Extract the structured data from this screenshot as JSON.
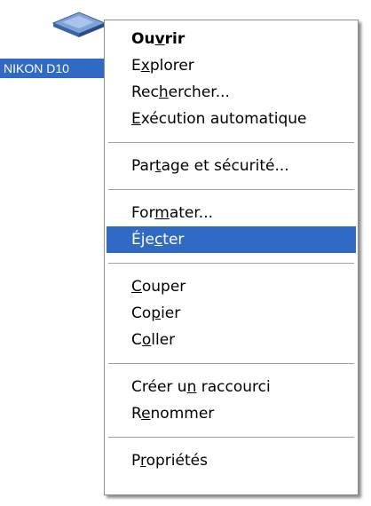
{
  "drive": {
    "label": "NIKON D10",
    "icon": "removable-drive-icon"
  },
  "menu": {
    "open": {
      "pre": "Ou",
      "mn": "v",
      "post": "rir"
    },
    "explore": {
      "pre": "E",
      "mn": "x",
      "post": "plorer"
    },
    "search": {
      "pre": "Rec",
      "mn": "h",
      "post": "ercher..."
    },
    "autoplay": {
      "pre": "",
      "mn": "E",
      "post": "xécution automatique",
      "full": "Exécution automatique"
    },
    "sharing": {
      "pre": "Par",
      "mn": "t",
      "post": "age et sécurité..."
    },
    "format": {
      "pre": "For",
      "mn": "m",
      "post": "ater..."
    },
    "eject": {
      "pre": "Éje",
      "mn": "c",
      "post": "ter"
    },
    "cut": {
      "pre": "",
      "mn": "C",
      "post": "ouper"
    },
    "copy": {
      "pre": "Co",
      "mn": "p",
      "post": "ier"
    },
    "paste": {
      "pre": "C",
      "mn": "o",
      "post": "ller"
    },
    "shortcut": {
      "pre": "Créer u",
      "mn": "n",
      "post": " raccourci"
    },
    "rename": {
      "pre": "R",
      "mn": "e",
      "post": "nommer"
    },
    "properties": {
      "pre": "P",
      "mn": "r",
      "post": "opriétés"
    }
  },
  "colors": {
    "highlight": "#316ac5",
    "menu_border": "#8d8d8d",
    "separator": "#a0a0a0"
  }
}
